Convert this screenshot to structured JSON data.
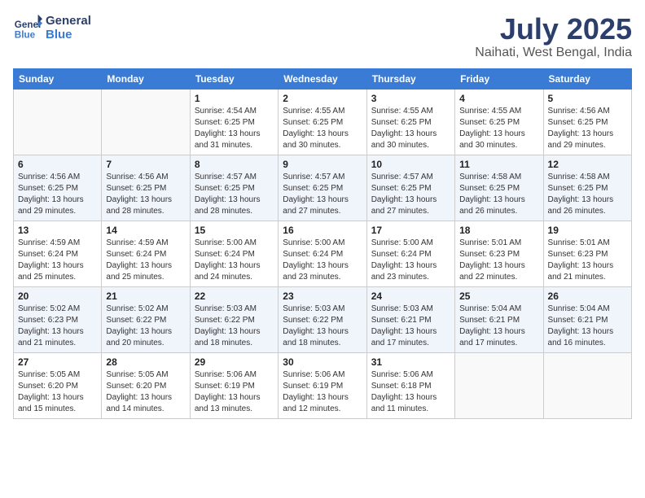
{
  "header": {
    "logo_line1": "General",
    "logo_line2": "Blue",
    "month": "July 2025",
    "location": "Naihati, West Bengal, India"
  },
  "weekdays": [
    "Sunday",
    "Monday",
    "Tuesday",
    "Wednesday",
    "Thursday",
    "Friday",
    "Saturday"
  ],
  "weeks": [
    [
      {
        "day": null
      },
      {
        "day": null
      },
      {
        "day": 1,
        "sunrise": "Sunrise: 4:54 AM",
        "sunset": "Sunset: 6:25 PM",
        "daylight": "Daylight: 13 hours and 31 minutes."
      },
      {
        "day": 2,
        "sunrise": "Sunrise: 4:55 AM",
        "sunset": "Sunset: 6:25 PM",
        "daylight": "Daylight: 13 hours and 30 minutes."
      },
      {
        "day": 3,
        "sunrise": "Sunrise: 4:55 AM",
        "sunset": "Sunset: 6:25 PM",
        "daylight": "Daylight: 13 hours and 30 minutes."
      },
      {
        "day": 4,
        "sunrise": "Sunrise: 4:55 AM",
        "sunset": "Sunset: 6:25 PM",
        "daylight": "Daylight: 13 hours and 30 minutes."
      },
      {
        "day": 5,
        "sunrise": "Sunrise: 4:56 AM",
        "sunset": "Sunset: 6:25 PM",
        "daylight": "Daylight: 13 hours and 29 minutes."
      }
    ],
    [
      {
        "day": 6,
        "sunrise": "Sunrise: 4:56 AM",
        "sunset": "Sunset: 6:25 PM",
        "daylight": "Daylight: 13 hours and 29 minutes."
      },
      {
        "day": 7,
        "sunrise": "Sunrise: 4:56 AM",
        "sunset": "Sunset: 6:25 PM",
        "daylight": "Daylight: 13 hours and 28 minutes."
      },
      {
        "day": 8,
        "sunrise": "Sunrise: 4:57 AM",
        "sunset": "Sunset: 6:25 PM",
        "daylight": "Daylight: 13 hours and 28 minutes."
      },
      {
        "day": 9,
        "sunrise": "Sunrise: 4:57 AM",
        "sunset": "Sunset: 6:25 PM",
        "daylight": "Daylight: 13 hours and 27 minutes."
      },
      {
        "day": 10,
        "sunrise": "Sunrise: 4:57 AM",
        "sunset": "Sunset: 6:25 PM",
        "daylight": "Daylight: 13 hours and 27 minutes."
      },
      {
        "day": 11,
        "sunrise": "Sunrise: 4:58 AM",
        "sunset": "Sunset: 6:25 PM",
        "daylight": "Daylight: 13 hours and 26 minutes."
      },
      {
        "day": 12,
        "sunrise": "Sunrise: 4:58 AM",
        "sunset": "Sunset: 6:25 PM",
        "daylight": "Daylight: 13 hours and 26 minutes."
      }
    ],
    [
      {
        "day": 13,
        "sunrise": "Sunrise: 4:59 AM",
        "sunset": "Sunset: 6:24 PM",
        "daylight": "Daylight: 13 hours and 25 minutes."
      },
      {
        "day": 14,
        "sunrise": "Sunrise: 4:59 AM",
        "sunset": "Sunset: 6:24 PM",
        "daylight": "Daylight: 13 hours and 25 minutes."
      },
      {
        "day": 15,
        "sunrise": "Sunrise: 5:00 AM",
        "sunset": "Sunset: 6:24 PM",
        "daylight": "Daylight: 13 hours and 24 minutes."
      },
      {
        "day": 16,
        "sunrise": "Sunrise: 5:00 AM",
        "sunset": "Sunset: 6:24 PM",
        "daylight": "Daylight: 13 hours and 23 minutes."
      },
      {
        "day": 17,
        "sunrise": "Sunrise: 5:00 AM",
        "sunset": "Sunset: 6:24 PM",
        "daylight": "Daylight: 13 hours and 23 minutes."
      },
      {
        "day": 18,
        "sunrise": "Sunrise: 5:01 AM",
        "sunset": "Sunset: 6:23 PM",
        "daylight": "Daylight: 13 hours and 22 minutes."
      },
      {
        "day": 19,
        "sunrise": "Sunrise: 5:01 AM",
        "sunset": "Sunset: 6:23 PM",
        "daylight": "Daylight: 13 hours and 21 minutes."
      }
    ],
    [
      {
        "day": 20,
        "sunrise": "Sunrise: 5:02 AM",
        "sunset": "Sunset: 6:23 PM",
        "daylight": "Daylight: 13 hours and 21 minutes."
      },
      {
        "day": 21,
        "sunrise": "Sunrise: 5:02 AM",
        "sunset": "Sunset: 6:22 PM",
        "daylight": "Daylight: 13 hours and 20 minutes."
      },
      {
        "day": 22,
        "sunrise": "Sunrise: 5:03 AM",
        "sunset": "Sunset: 6:22 PM",
        "daylight": "Daylight: 13 hours and 18 minutes."
      },
      {
        "day": 23,
        "sunrise": "Sunrise: 5:03 AM",
        "sunset": "Sunset: 6:22 PM",
        "daylight": "Daylight: 13 hours and 18 minutes."
      },
      {
        "day": 24,
        "sunrise": "Sunrise: 5:03 AM",
        "sunset": "Sunset: 6:21 PM",
        "daylight": "Daylight: 13 hours and 17 minutes."
      },
      {
        "day": 25,
        "sunrise": "Sunrise: 5:04 AM",
        "sunset": "Sunset: 6:21 PM",
        "daylight": "Daylight: 13 hours and 17 minutes."
      },
      {
        "day": 26,
        "sunrise": "Sunrise: 5:04 AM",
        "sunset": "Sunset: 6:21 PM",
        "daylight": "Daylight: 13 hours and 16 minutes."
      }
    ],
    [
      {
        "day": 27,
        "sunrise": "Sunrise: 5:05 AM",
        "sunset": "Sunset: 6:20 PM",
        "daylight": "Daylight: 13 hours and 15 minutes."
      },
      {
        "day": 28,
        "sunrise": "Sunrise: 5:05 AM",
        "sunset": "Sunset: 6:20 PM",
        "daylight": "Daylight: 13 hours and 14 minutes."
      },
      {
        "day": 29,
        "sunrise": "Sunrise: 5:06 AM",
        "sunset": "Sunset: 6:19 PM",
        "daylight": "Daylight: 13 hours and 13 minutes."
      },
      {
        "day": 30,
        "sunrise": "Sunrise: 5:06 AM",
        "sunset": "Sunset: 6:19 PM",
        "daylight": "Daylight: 13 hours and 12 minutes."
      },
      {
        "day": 31,
        "sunrise": "Sunrise: 5:06 AM",
        "sunset": "Sunset: 6:18 PM",
        "daylight": "Daylight: 13 hours and 11 minutes."
      },
      {
        "day": null
      },
      {
        "day": null
      }
    ]
  ]
}
